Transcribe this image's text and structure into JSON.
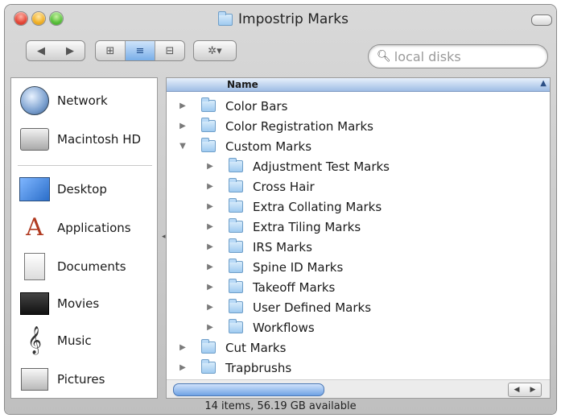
{
  "window": {
    "title": "Impostrip Marks"
  },
  "toolbar": {
    "back_label": "◀",
    "forward_label": "▶",
    "view_icon": "⊞",
    "view_list": "≡",
    "view_column": "⊟",
    "action_label": "✲▾",
    "search_placeholder": "local disks"
  },
  "sidebar": {
    "items": [
      {
        "label": "Network",
        "icon": "network-icon"
      },
      {
        "label": "Macintosh HD",
        "icon": "hard-drive-icon"
      },
      {
        "label": "Desktop",
        "icon": "desktop-icon"
      },
      {
        "label": "Applications",
        "icon": "applications-icon"
      },
      {
        "label": "Documents",
        "icon": "documents-icon"
      },
      {
        "label": "Movies",
        "icon": "movies-icon"
      },
      {
        "label": "Music",
        "icon": "music-icon"
      },
      {
        "label": "Pictures",
        "icon": "pictures-icon"
      }
    ]
  },
  "list": {
    "column_name": "Name",
    "rows": [
      {
        "label": "Color Bars",
        "level": 0,
        "expanded": false
      },
      {
        "label": "Color Registration Marks",
        "level": 0,
        "expanded": false
      },
      {
        "label": "Custom Marks",
        "level": 0,
        "expanded": true
      },
      {
        "label": "Adjustment Test Marks",
        "level": 1,
        "expanded": false
      },
      {
        "label": "Cross Hair",
        "level": 1,
        "expanded": false
      },
      {
        "label": "Extra Collating Marks",
        "level": 1,
        "expanded": false
      },
      {
        "label": "Extra Tiling Marks",
        "level": 1,
        "expanded": false
      },
      {
        "label": "IRS Marks",
        "level": 1,
        "expanded": false
      },
      {
        "label": "Spine ID Marks",
        "level": 1,
        "expanded": false
      },
      {
        "label": "Takeoff Marks",
        "level": 1,
        "expanded": false
      },
      {
        "label": "User Defined Marks",
        "level": 1,
        "expanded": false
      },
      {
        "label": "Workflows",
        "level": 1,
        "expanded": false
      },
      {
        "label": "Cut Marks",
        "level": 0,
        "expanded": false
      },
      {
        "label": "Trapbrushs",
        "level": 0,
        "expanded": false
      }
    ]
  },
  "status": {
    "text": "14 items, 56.19 GB available"
  },
  "colors": {
    "selection_blue": "#79aee8",
    "folder_blue": "#9fcaf0"
  }
}
